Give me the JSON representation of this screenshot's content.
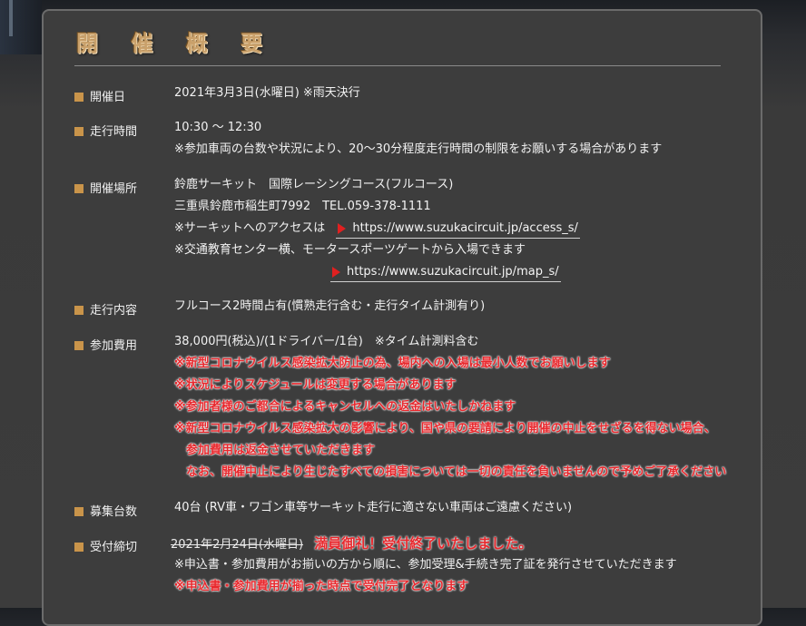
{
  "title": "開 催 概 要",
  "rows": {
    "date": {
      "label": "開催日",
      "lines": [
        "2021年3月3日(水曜日) ※雨天決行"
      ]
    },
    "time": {
      "label": "走行時間",
      "lines": [
        "10:30 ～ 12:30",
        "※参加車両の台数や状況により、20～30分程度走行時間の制限をお願いする場合があります"
      ]
    },
    "place": {
      "label": "開催場所",
      "line1": "鈴鹿サーキット　国際レーシングコース(フルコース)",
      "line2": "三重県鈴鹿市稲生町7992　TEL.059-378-1111",
      "access_note": "※サーキットへのアクセスは",
      "access_url": "https://www.suzukacircuit.jp/access_s/",
      "gate_note": "※交通教育センター横、モータースポーツゲートから入場できます",
      "map_url": "https://www.suzukacircuit.jp/map_s/"
    },
    "content": {
      "label": "走行内容",
      "lines": [
        "フルコース2時間占有(慣熟走行含む・走行タイム計測有り)"
      ]
    },
    "fee": {
      "label": "参加費用",
      "line1": "38,000円(税込)/(1ドライバー/1台)　※タイム計測料含む",
      "notes": [
        "※新型コロナウイルス感染拡大防止の為、場内への入場は最小人数でお願いします",
        "※状況によりスケジュールは変更する場合があります",
        "※参加者様のご都合によるキャンセルへの返金はいたしかねます",
        "※新型コロナウイルス感染拡大の影響により、国や県の要請により開催の中止をせざるを得ない場合、",
        "　参加費用は返金させていただきます",
        "　なお、開催中止により生じたすべての損害については一切の責任を負いませんので予めご了承ください"
      ]
    },
    "capacity": {
      "label": "募集台数",
      "lines": [
        "40台 (RV車・ワゴン車等サーキット走行に適さない車両はご遠慮ください)"
      ]
    },
    "deadline": {
      "label": "受付締切",
      "old_date": "2021年2月24日(水曜日)",
      "closed_msg": "満員御礼！受付終了いたしました。",
      "note1": "※申込書・参加費用がお揃いの方から順に、参加受理&手続き完了証を発行させていただきます",
      "note2": "※申込書・参加費用が揃った時点で受付完了となります"
    }
  },
  "colors": {
    "accent": "#c9944a",
    "red": "#e8282d"
  }
}
